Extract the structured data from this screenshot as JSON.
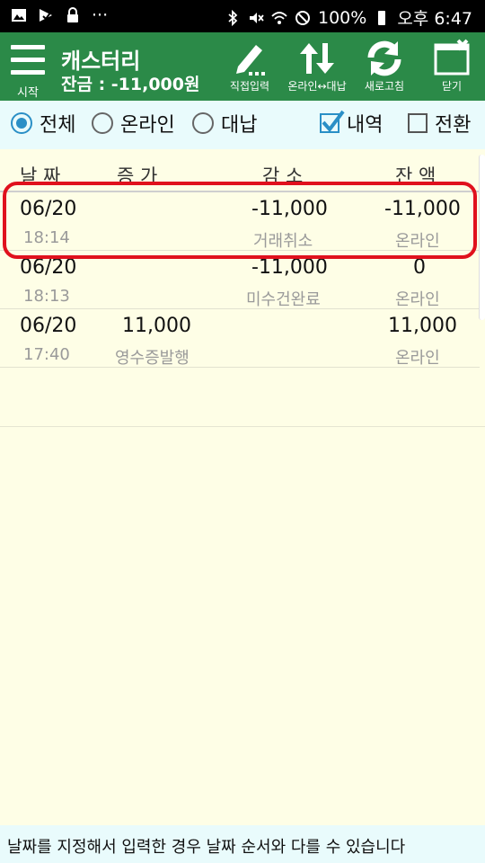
{
  "status_bar": {
    "battery": "100%",
    "time": "오후 6:47",
    "dots": "···"
  },
  "toolbar": {
    "menu_label": "시작",
    "title": "캐스터리",
    "balance": "잔금 : -11,000원",
    "buttons": {
      "direct_input": "직접입력",
      "online_offline": "온라인↔대납",
      "refresh": "새로고침",
      "close": "닫기"
    }
  },
  "filters": {
    "all": "전체",
    "online": "온라인",
    "offline": "대납",
    "history": "내역",
    "conversion": "전환",
    "selected_radio": "전체",
    "history_checked": true,
    "conversion_checked": false
  },
  "table": {
    "headers": {
      "date": "날 짜",
      "increase": "증 가",
      "decrease": "감 소",
      "balance": "잔 액"
    },
    "rows": [
      {
        "date": "06/20",
        "time": "18:14",
        "increase": "",
        "decrease": "-11,000",
        "note": "거래취소",
        "balance": "-11,000",
        "channel": "온라인"
      },
      {
        "date": "06/20",
        "time": "18:13",
        "increase": "",
        "decrease": "-11,000",
        "note": "미수건완료",
        "balance": "0",
        "channel": "온라인"
      },
      {
        "date": "06/20",
        "time": "17:40",
        "increase": "11,000",
        "decrease": "",
        "note": "영수증발행",
        "balance": "11,000",
        "channel": "온라인"
      }
    ]
  },
  "footer": {
    "notice": "날짜를 지정해서 입력한 경우 날짜 순서와 다를 수 있습니다"
  },
  "colors": {
    "toolbar": "#2b8a48",
    "highlight": "#e0111d",
    "accent": "#2a8fc6"
  }
}
